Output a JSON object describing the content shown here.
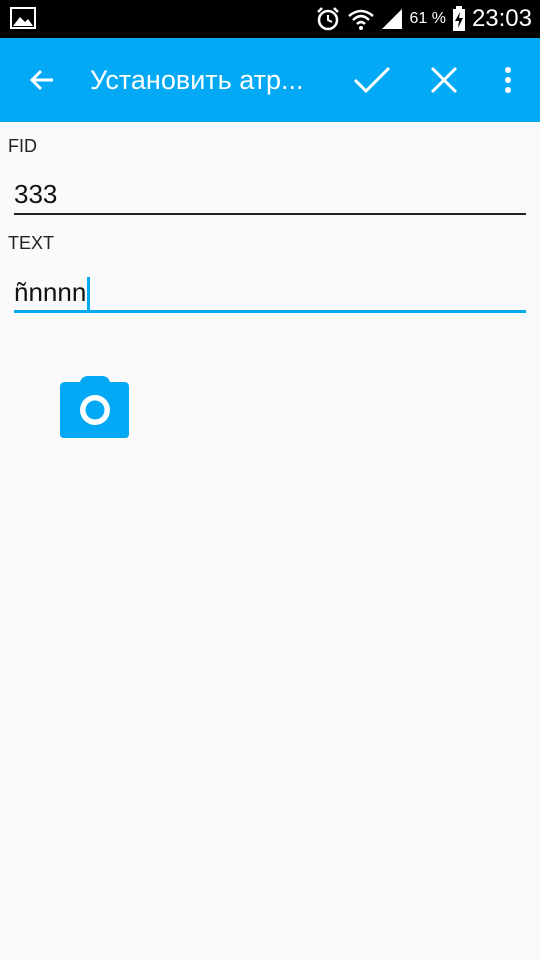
{
  "status_bar": {
    "battery_percent": "61 %",
    "time": "23:03",
    "icons": [
      "image-notification-icon",
      "alarm-icon",
      "wifi-icon",
      "signal-icon",
      "battery-charging-icon"
    ]
  },
  "action_bar": {
    "title": "Установить атр...",
    "icons": [
      "back-arrow-icon",
      "check-icon",
      "close-icon",
      "more-vert-icon"
    ],
    "color": "#03a9f4"
  },
  "form": {
    "fid": {
      "label": "FID",
      "value": "333"
    },
    "text": {
      "label": "TEXT",
      "value": "ñnnnn"
    }
  },
  "camera": {
    "icon": "camera-icon",
    "color": "#03a9f4"
  }
}
